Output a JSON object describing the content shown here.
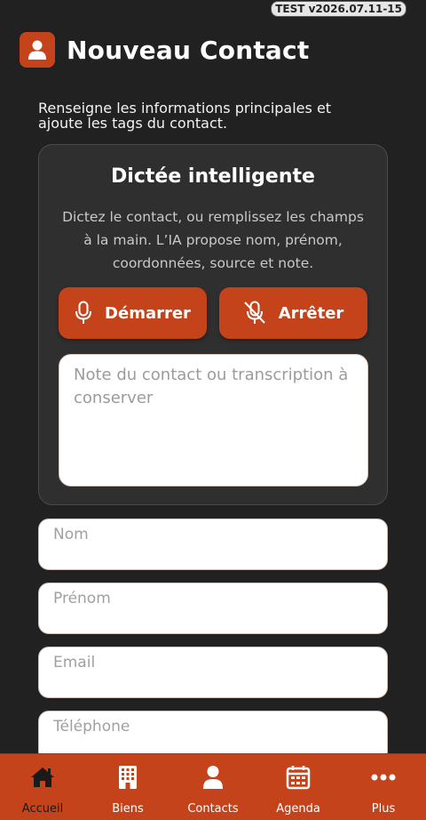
{
  "version_badge": "TEST v2026.07.11-15",
  "header": {
    "title": "Nouveau Contact",
    "icon": "user-icon"
  },
  "intro": "Renseigne les informations principales et ajoute les tags du contact.",
  "dictation": {
    "title": "Dictée intelligente",
    "description": "Dictez le contact, ou remplissez les champs à la main. L’IA propose nom, prénom, coordonnées, source et note.",
    "start_label": "Démarrer",
    "stop_label": "Arrêter",
    "note_placeholder": "Note du contact ou transcription à conserver",
    "note_value": ""
  },
  "fields": {
    "nom": {
      "placeholder": "Nom",
      "value": ""
    },
    "prenom": {
      "placeholder": "Prénom",
      "value": ""
    },
    "email": {
      "placeholder": "Email",
      "value": ""
    },
    "telephone": {
      "placeholder": "Téléphone",
      "value": ""
    }
  },
  "nav": {
    "items": [
      {
        "label": "Accueil",
        "icon": "home-icon",
        "active": true
      },
      {
        "label": "Biens",
        "icon": "building-icon",
        "active": false
      },
      {
        "label": "Contacts",
        "icon": "user-icon",
        "active": false
      },
      {
        "label": "Agenda",
        "icon": "calendar-icon",
        "active": false
      },
      {
        "label": "Plus",
        "icon": "more-icon",
        "active": false
      }
    ]
  },
  "colors": {
    "background": "#212121",
    "accent": "#c5431a",
    "card": "#2f2f2f",
    "nav_active_label": "#1a1a1a"
  }
}
